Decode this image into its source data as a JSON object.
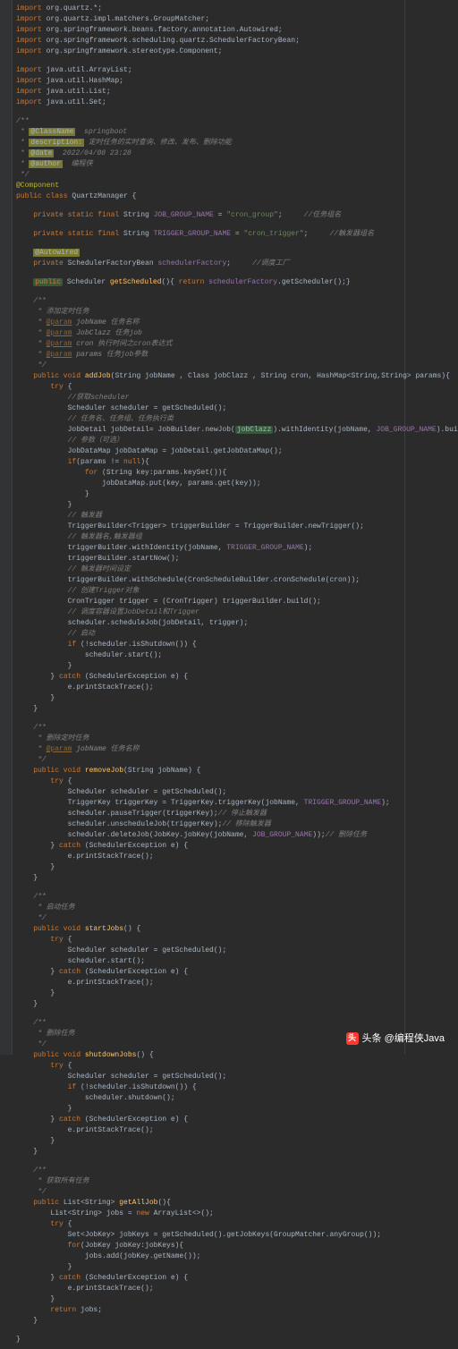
{
  "imports": [
    {
      "pkg": "org.quartz.",
      "wildcard": "*"
    },
    {
      "pkg": "org.quartz.impl.matchers.",
      "cls": "GroupMatcher"
    },
    {
      "pkg": "org.springframework.beans.factory.annotation.",
      "cls": "Autowired"
    },
    {
      "pkg": "org.springframework.scheduling.quartz.",
      "cls": "SchedulerFactoryBean"
    },
    {
      "pkg": "org.springframework.stereotype.",
      "cls": "Component"
    }
  ],
  "imports2": [
    {
      "pkg": "java.util.",
      "cls": "ArrayList"
    },
    {
      "pkg": "java.util.",
      "cls": "HashMap"
    },
    {
      "pkg": "java.util.",
      "cls": "List"
    },
    {
      "pkg": "java.util.",
      "cls": "Set"
    }
  ],
  "doc_header": {
    "class_name": "springboot",
    "desc": "定时任务的实时查询、修改、发布、删除功能",
    "date": "2022/04/08 23:28",
    "author": "编程侠"
  },
  "class_ann": "@Component",
  "class_decl": {
    "mod": "public class",
    "name": "QuartzManager"
  },
  "field_job": {
    "mod": "private static final",
    "type": "String",
    "name": "JOB_GROUP_NAME",
    "val": "\"cron_group\"",
    "cmt": "//任务组名"
  },
  "field_trig": {
    "mod": "private static final",
    "type": "String",
    "name": "TRIGGER_GROUP_NAME",
    "val": "\"cron_trigger\"",
    "cmt": "//触发器组名"
  },
  "autowired": "@Autowired",
  "field_factory": {
    "mod": "private",
    "type": "SchedulerFactoryBean",
    "name": "schedulerFactory",
    "cmt": "//调度工厂"
  },
  "getScheduled": {
    "mod": "public",
    "ret": "Scheduler",
    "name": "getScheduled",
    "body": "return schedulerFactory.getScheduler();"
  },
  "addJob": {
    "doc_title": "添加定时任务",
    "params": [
      {
        "tag": "@param",
        "name": "jobName",
        "desc": "任务名称"
      },
      {
        "tag": "@param",
        "name": "JobClazz",
        "desc": "任务job"
      },
      {
        "tag": "@param",
        "name": "cron",
        "desc": "执行时间之cron表达式"
      },
      {
        "tag": "@param",
        "name": "params",
        "desc": "任务job参数"
      }
    ],
    "sig": "public void addJob(String jobName , Class jobClazz , String cron, HashMap<String,String> params){",
    "lines": [
      {
        "txt": "try {",
        "indent": 2
      },
      {
        "txt": "//获取scheduler",
        "indent": 3,
        "com": true
      },
      {
        "txt": "Scheduler scheduler = getScheduled();",
        "indent": 3
      },
      {
        "txt": "// 任务名、任务组、任务执行类",
        "indent": 3,
        "com": true
      },
      {
        "txt": "JobDetail jobDetail= JobBuilder.newJob(jobClazz).withIdentity(jobName, JOB_GROUP_NAME).build();",
        "indent": 3,
        "special": "jobdetail"
      },
      {
        "txt": "// 参数（可选）",
        "indent": 3,
        "com": true
      },
      {
        "txt": "JobDataMap jobDataMap = jobDetail.getJobDataMap();",
        "indent": 3
      },
      {
        "txt": "if(params != null){",
        "indent": 3,
        "special": "ifnull"
      },
      {
        "txt": "for (String key:params.keySet()){",
        "indent": 4,
        "special": "for"
      },
      {
        "txt": "jobDataMap.put(key, params.get(key));",
        "indent": 5
      },
      {
        "txt": "}",
        "indent": 4
      },
      {
        "txt": "}",
        "indent": 3
      },
      {
        "txt": "// 触发器",
        "indent": 3,
        "com": true
      },
      {
        "txt": "TriggerBuilder<Trigger> triggerBuilder = TriggerBuilder.newTrigger();",
        "indent": 3
      },
      {
        "txt": "// 触发器名,触发器组",
        "indent": 3,
        "com": true
      },
      {
        "txt": "triggerBuilder.withIdentity(jobName, TRIGGER_GROUP_NAME);",
        "indent": 3,
        "special": "trig1"
      },
      {
        "txt": "triggerBuilder.startNow();",
        "indent": 3
      },
      {
        "txt": "// 触发器时间设定",
        "indent": 3,
        "com": true
      },
      {
        "txt": "triggerBuilder.withSchedule(CronScheduleBuilder.cronSchedule(cron));",
        "indent": 3
      },
      {
        "txt": "// 创建Trigger对象",
        "indent": 3,
        "com": true
      },
      {
        "txt": "CronTrigger trigger = (CronTrigger) triggerBuilder.build();",
        "indent": 3
      },
      {
        "txt": "// 调度容器设置JobDetail和Trigger",
        "indent": 3,
        "com": true
      },
      {
        "txt": "scheduler.scheduleJob(jobDetail, trigger);",
        "indent": 3
      },
      {
        "txt": "// 启动",
        "indent": 3,
        "com": true
      },
      {
        "txt": "if (!scheduler.isShutdown()) {",
        "indent": 3,
        "special": "if"
      },
      {
        "txt": "scheduler.start();",
        "indent": 4
      },
      {
        "txt": "}",
        "indent": 3
      },
      {
        "txt": "} catch (SchedulerException e) {",
        "indent": 2,
        "special": "catch"
      },
      {
        "txt": "e.printStackTrace();",
        "indent": 3
      },
      {
        "txt": "}",
        "indent": 2
      }
    ]
  },
  "removeJob": {
    "doc_title": "删除定时任务",
    "params": [
      {
        "tag": "@param",
        "name": "jobName",
        "desc": "任务名称"
      }
    ],
    "sig": "public void removeJob(String jobName) {",
    "lines": [
      {
        "txt": "try {",
        "indent": 2
      },
      {
        "txt": "Scheduler scheduler = getScheduled();",
        "indent": 3
      },
      {
        "txt": "TriggerKey triggerKey = TriggerKey.triggerKey(jobName, TRIGGER_GROUP_NAME);",
        "indent": 3,
        "special": "tk"
      },
      {
        "txt": "scheduler.pauseTrigger(triggerKey);// 停止触发器",
        "indent": 3,
        "special": "cmt1"
      },
      {
        "txt": "scheduler.unscheduleJob(triggerKey);// 移除触发器",
        "indent": 3,
        "special": "cmt2"
      },
      {
        "txt": "scheduler.deleteJob(JobKey.jobKey(jobName, JOB_GROUP_NAME));// 删除任务",
        "indent": 3,
        "special": "cmt3"
      },
      {
        "txt": "} catch (SchedulerException e) {",
        "indent": 2,
        "special": "catch"
      },
      {
        "txt": "e.printStackTrace();",
        "indent": 3
      },
      {
        "txt": "}",
        "indent": 2
      }
    ]
  },
  "startJobs": {
    "doc_title": "启动任务",
    "sig": "public void startJobs() {",
    "lines": [
      {
        "txt": "try {",
        "indent": 2
      },
      {
        "txt": "Scheduler scheduler = getScheduled();",
        "indent": 3
      },
      {
        "txt": "scheduler.start();",
        "indent": 3
      },
      {
        "txt": "} catch (SchedulerException e) {",
        "indent": 2,
        "special": "catch"
      },
      {
        "txt": "e.printStackTrace();",
        "indent": 3
      },
      {
        "txt": "}",
        "indent": 2
      }
    ]
  },
  "shutdownJobs": {
    "doc_title": "删除任务",
    "sig": "public void shutdownJobs() {",
    "lines": [
      {
        "txt": "try {",
        "indent": 2
      },
      {
        "txt": "Scheduler scheduler = getScheduled();",
        "indent": 3
      },
      {
        "txt": "if (!scheduler.isShutdown()) {",
        "indent": 3,
        "special": "if"
      },
      {
        "txt": "scheduler.shutdown();",
        "indent": 4
      },
      {
        "txt": "}",
        "indent": 3
      },
      {
        "txt": "} catch (SchedulerException e) {",
        "indent": 2,
        "special": "catch"
      },
      {
        "txt": "e.printStackTrace();",
        "indent": 3
      },
      {
        "txt": "}",
        "indent": 2
      }
    ]
  },
  "getAllJob": {
    "doc_title": "获取所有任务",
    "sig": "public List<String> getAllJob(){",
    "lines": [
      {
        "txt": "List<String> jobs = new ArrayList<>();",
        "indent": 2,
        "special": "new"
      },
      {
        "txt": "try {",
        "indent": 2
      },
      {
        "txt": "Set<JobKey> jobKeys = getScheduled().getJobKeys(GroupMatcher.anyGroup());",
        "indent": 3
      },
      {
        "txt": "for(JobKey jobKey:jobKeys){",
        "indent": 3,
        "special": "for"
      },
      {
        "txt": "jobs.add(jobKey.getName());",
        "indent": 4
      },
      {
        "txt": "}",
        "indent": 3
      },
      {
        "txt": "} catch (SchedulerException e) {",
        "indent": 2,
        "special": "catch"
      },
      {
        "txt": "e.printStackTrace();",
        "indent": 3
      },
      {
        "txt": "}",
        "indent": 2
      },
      {
        "txt": "return jobs;",
        "indent": 2,
        "special": "ret"
      }
    ]
  },
  "watermark": "头条 @编程侠Java"
}
